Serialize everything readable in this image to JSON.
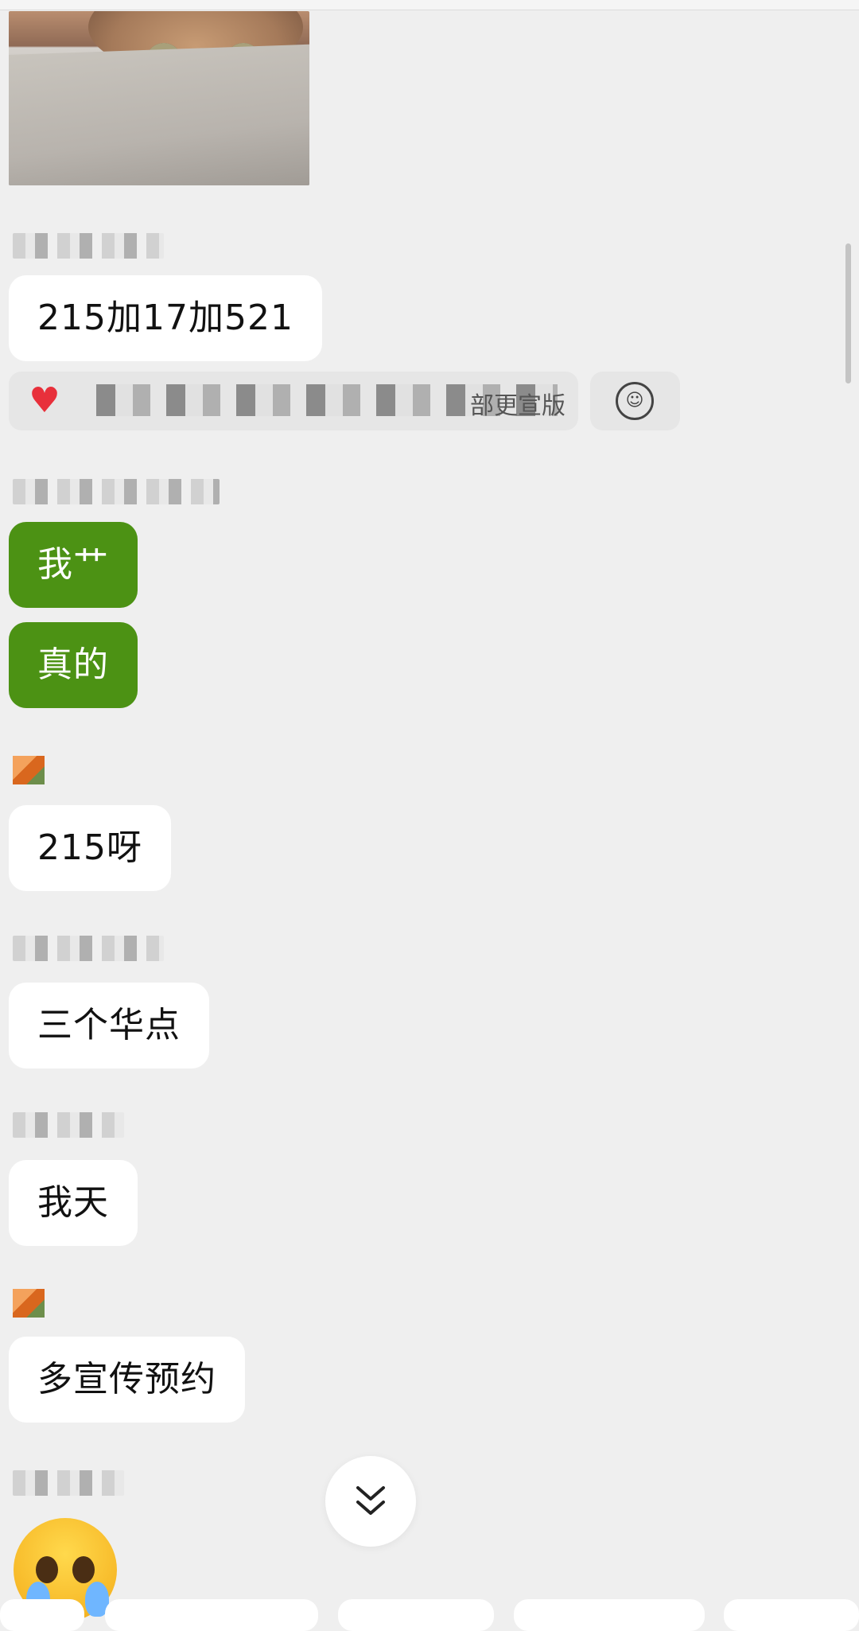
{
  "messages": {
    "m1": "215加17加521",
    "m2": "我艹",
    "m3": "真的",
    "m4": "215呀",
    "m5": "三个华点",
    "m6": "我天",
    "m7": "多宣传预约"
  },
  "reply_preview": {
    "visible_tail": "部更宣版"
  },
  "icons": {
    "reply_heart": "heart-icon",
    "emoji": "emoji-face-icon",
    "scroll_down": "double-chevron-down-icon",
    "sticker": "pleading-crying-face-emoji"
  },
  "colors": {
    "background": "#efefef",
    "bubble_white": "#ffffff",
    "bubble_green": "#4c9214",
    "heart": "#e8303b"
  }
}
